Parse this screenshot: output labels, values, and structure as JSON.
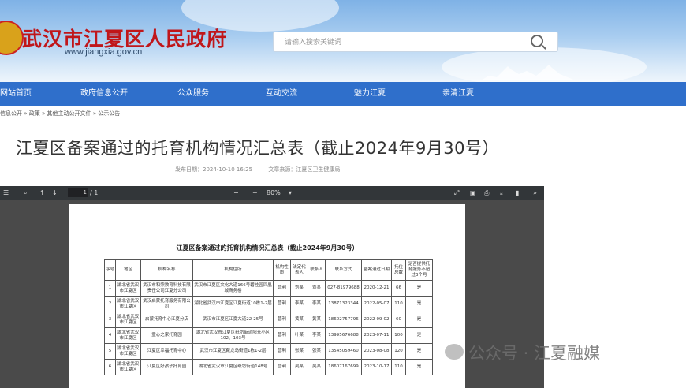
{
  "site": {
    "name": "武汉市江夏区人民政府",
    "url": "www.jiangxia.gov.cn",
    "search_placeholder": "请输入搜索关键词"
  },
  "nav": [
    "网站首页",
    "政府信息公开",
    "公众服务",
    "互动交流",
    "魅力江夏",
    "亲清江夏"
  ],
  "breadcrumb": "信息公开 » 政策 » 其他主动公开文件 » 公示公告",
  "article": {
    "title": "江夏区备案通过的托育机构情况汇总表（截止2024年9月30号）",
    "publish_time": "发布日期：2024-10-10 16:25",
    "source": "文章来源：江夏区卫生健康局"
  },
  "pdf_toolbar": {
    "page": "1",
    "total": "/ 1",
    "zoom": "80%",
    "zoom_out": "−",
    "zoom_in": "+"
  },
  "document": {
    "title": "江夏区备案通过的托育机构情况汇总表（截止2024年9月30号）",
    "headers": [
      "序号",
      "地区",
      "机构名称",
      "机构住所",
      "机构性质",
      "法定代表人",
      "联系人",
      "联系方式",
      "备案通过日期",
      "托位总数",
      "是否提供托育服务不超过3个月"
    ],
    "rows": [
      [
        "1",
        "湖北省武汉市江夏区",
        "武汉市和煦教育科技有限责任公司江夏分公司",
        "武汉市江夏区文化大道166号碧桂园凤凰城商务楼",
        "营利",
        "刘某",
        "刘某",
        "027-81979688",
        "2020-12-21",
        "66",
        "是"
      ],
      [
        "2",
        "湖北省武汉市江夏区",
        "武汉启蒙托育服务有限公司",
        "湖北省武汉市江夏区江夏街道10栋1-2层",
        "营利",
        "李某",
        "李某",
        "13871323344",
        "2022-05-07",
        "110",
        "是"
      ],
      [
        "3",
        "湖北省武汉市江夏区",
        "启蒙托育中心江夏分店",
        "武汉市江夏区江夏大道22-25号",
        "营利",
        "黄某",
        "黄某",
        "18602757796",
        "2022-09-02",
        "60",
        "是"
      ],
      [
        "4",
        "湖北省武汉市江夏区",
        "童心之家托育园",
        "湖北省武汉市江夏区纸坊街道阳光小区102、103号",
        "营利",
        "叶某",
        "李某",
        "13995676688",
        "2023-07-11",
        "100",
        "是"
      ],
      [
        "5",
        "湖北省武汉市江夏区",
        "江夏区幸福托育中心",
        "武汉市江夏区藏龙岛街道1栋1-2层",
        "营利",
        "张某",
        "张某",
        "13545059460",
        "2023-08-08",
        "120",
        "是"
      ],
      [
        "6",
        "湖北省武汉市江夏区",
        "江夏区好孩子托育园",
        "湖北省武汉市江夏区纸坊街道148号",
        "营利",
        "吴某",
        "吴某",
        "18607167699",
        "2023-10-17",
        "110",
        "是"
      ]
    ]
  },
  "watermark": "公众号 · 江夏融媒"
}
